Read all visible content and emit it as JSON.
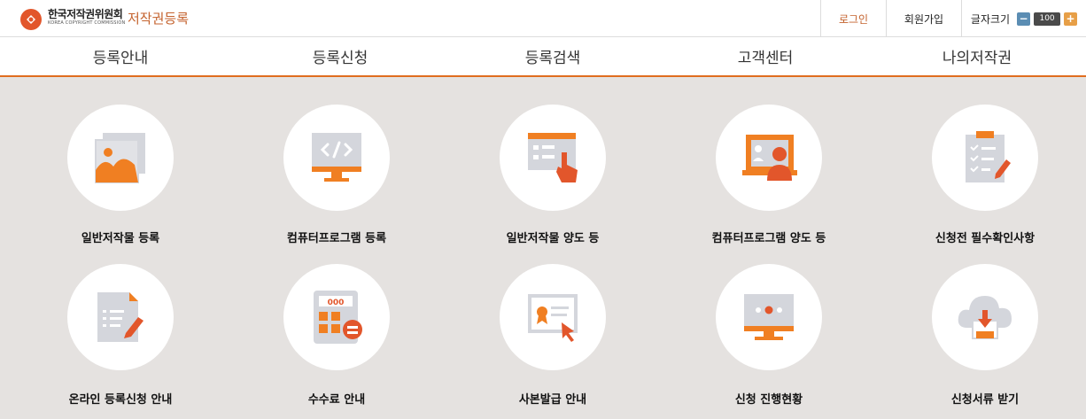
{
  "header": {
    "logo_ko": "한국저작권위원회",
    "logo_en": "KOREA COPYRIGHT COMMISSION",
    "site_title": "저작권등록",
    "login": "로그인",
    "join": "회원가입",
    "font_size_label": "글자크기",
    "font_minus": "−",
    "font_value": "100",
    "font_plus": "+"
  },
  "nav": [
    "등록안내",
    "등록신청",
    "등록검색",
    "고객센터",
    "나의저작권"
  ],
  "services": [
    {
      "label": "일반저작물 등록",
      "icon": "image-document-icon"
    },
    {
      "label": "컴퓨터프로그램 등록",
      "icon": "code-monitor-icon"
    },
    {
      "label": "일반저작물 양도 등",
      "icon": "form-hand-pointer-icon"
    },
    {
      "label": "컴퓨터프로그램 양도 등",
      "icon": "user-monitor-icon"
    },
    {
      "label": "신청전 필수확인사항",
      "icon": "clipboard-checklist-icon"
    },
    {
      "label": "온라인 등록신청 안내",
      "icon": "document-pencil-icon"
    },
    {
      "label": "수수료 안내",
      "icon": "calculator-icon"
    },
    {
      "label": "사본발급 안내",
      "icon": "certificate-cursor-icon"
    },
    {
      "label": "신청 진행현황",
      "icon": "progress-monitor-icon"
    },
    {
      "label": "신청서류 받기",
      "icon": "cloud-download-icon"
    }
  ],
  "colors": {
    "accent": "#f07f22",
    "accent_dark": "#e2562b",
    "icon_gray": "#d4d6dc",
    "background": "#e5e2e0"
  }
}
